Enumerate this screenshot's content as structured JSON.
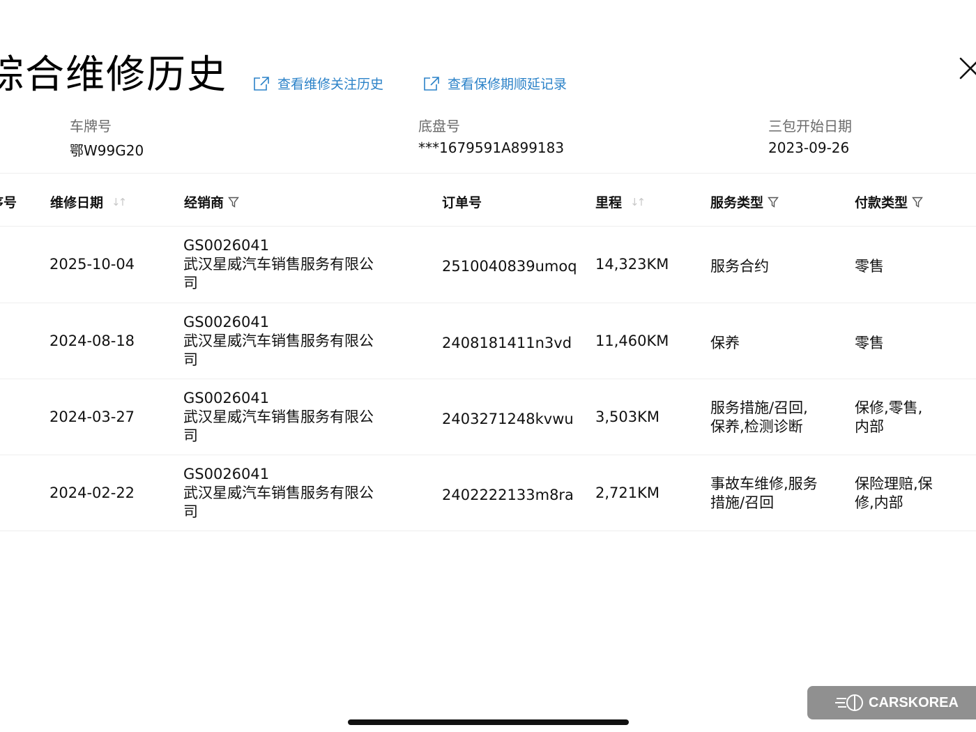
{
  "title": "综合维修历史",
  "links": [
    {
      "label": "查看维修关注历史",
      "icon": "external-link-icon"
    },
    {
      "label": "查看保修期顺延记录",
      "icon": "external-link-icon"
    }
  ],
  "close_icon": "close-icon",
  "vehicle": {
    "plate_label": "车牌号",
    "plate_value": "鄂W99G20",
    "chassis_label": "底盘号",
    "chassis_value": "***1679591A899183",
    "warranty_label": "三包开始日期",
    "warranty_value": "2023-09-26"
  },
  "table": {
    "columns": {
      "index": "序号",
      "date": "维修日期",
      "dealer": "经销商",
      "order": "订单号",
      "mileage": "里程",
      "service": "服务类型",
      "payment": "付款类型"
    },
    "rows": [
      {
        "date": "2025-10-04",
        "dealer_code": "GS0026041",
        "dealer_name_l1": "武汉星威汽车销售服务有限公",
        "dealer_name_l2": "司",
        "order": "2510040839umoq",
        "mileage": "14,323KM",
        "service_l1": "服务合约",
        "service_l2": "",
        "payment_l1": "零售",
        "payment_l2": ""
      },
      {
        "date": "2024-08-18",
        "dealer_code": "GS0026041",
        "dealer_name_l1": "武汉星威汽车销售服务有限公",
        "dealer_name_l2": "司",
        "order": "2408181411n3vd",
        "mileage": "11,460KM",
        "service_l1": "保养",
        "service_l2": "",
        "payment_l1": "零售",
        "payment_l2": ""
      },
      {
        "date": "2024-03-27",
        "dealer_code": "GS0026041",
        "dealer_name_l1": "武汉星威汽车销售服务有限公",
        "dealer_name_l2": "司",
        "order": "2403271248kvwu",
        "mileage": "3,503KM",
        "service_l1": "服务措施/召回,",
        "service_l2": "保养,检测诊断",
        "payment_l1": "保修,零售,",
        "payment_l2": "内部"
      },
      {
        "date": "2024-02-22",
        "dealer_code": "GS0026041",
        "dealer_name_l1": "武汉星威汽车销售服务有限公",
        "dealer_name_l2": "司",
        "order": "2402222133m8ra",
        "mileage": "2,721KM",
        "service_l1": "事故车维修,服务",
        "service_l2": "措施/召回",
        "payment_l1": "保险理赔,保",
        "payment_l2": "修,内部"
      }
    ]
  },
  "watermark": {
    "text": "CARSKOREA",
    "logo": "carskorea-logo"
  },
  "colors": {
    "link": "#2b82c8",
    "label_gray": "#6b6b6b"
  }
}
